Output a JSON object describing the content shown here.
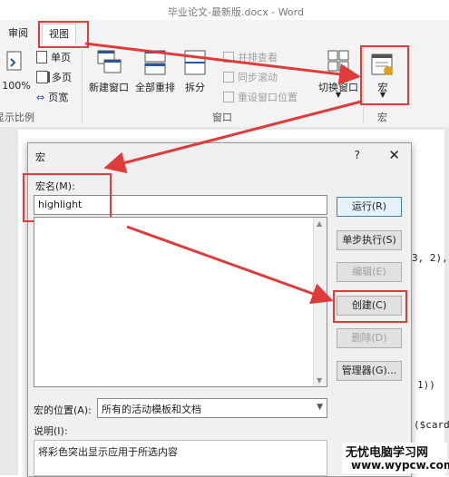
{
  "window": {
    "title": "毕业论文-最新版.docx - Word"
  },
  "tabs": [
    {
      "label": "审阅"
    },
    {
      "label": "视图"
    }
  ],
  "ribbon": {
    "zoom_label": "100%",
    "single_page": "单页",
    "multi_page": "多页",
    "page_width": "页宽",
    "zoom_group": "显示比例",
    "new_window": "新建窗口",
    "arrange_all": "全部重排",
    "split": "拆分",
    "side_by_side": "并排查看",
    "sync_scroll": "同步滚动",
    "reset_position": "重设窗口位置",
    "switch_window": "切换窗口",
    "window_group": "窗口",
    "macro": "宏",
    "macro_group": "宏"
  },
  "doc_code": [
    "3, 2),",
    "1)) ",
    "($card"
  ],
  "dialog": {
    "title": "宏",
    "help": "?",
    "close": "✕",
    "name_label": "宏名(M):",
    "name_value": "highlight",
    "location_label": "宏的位置(A):",
    "location_value": "所有的活动模板和文档",
    "desc_label": "说明(I):",
    "desc_value": "将彩色突出显示应用于所选内容",
    "buttons": {
      "run": "运行(R)",
      "step": "单步执行(S)",
      "edit": "编辑(E)",
      "create": "创建(C)",
      "delete": "删除(D)",
      "organizer": "管理器(G)..."
    }
  },
  "watermark": {
    "line1": "无忧电脑学习网",
    "line2": "www.wypcw.com"
  },
  "colors": {
    "annotation": "#e03b3b",
    "ribbon_bg": "#f3f3f3",
    "accent": "#2b579a"
  }
}
